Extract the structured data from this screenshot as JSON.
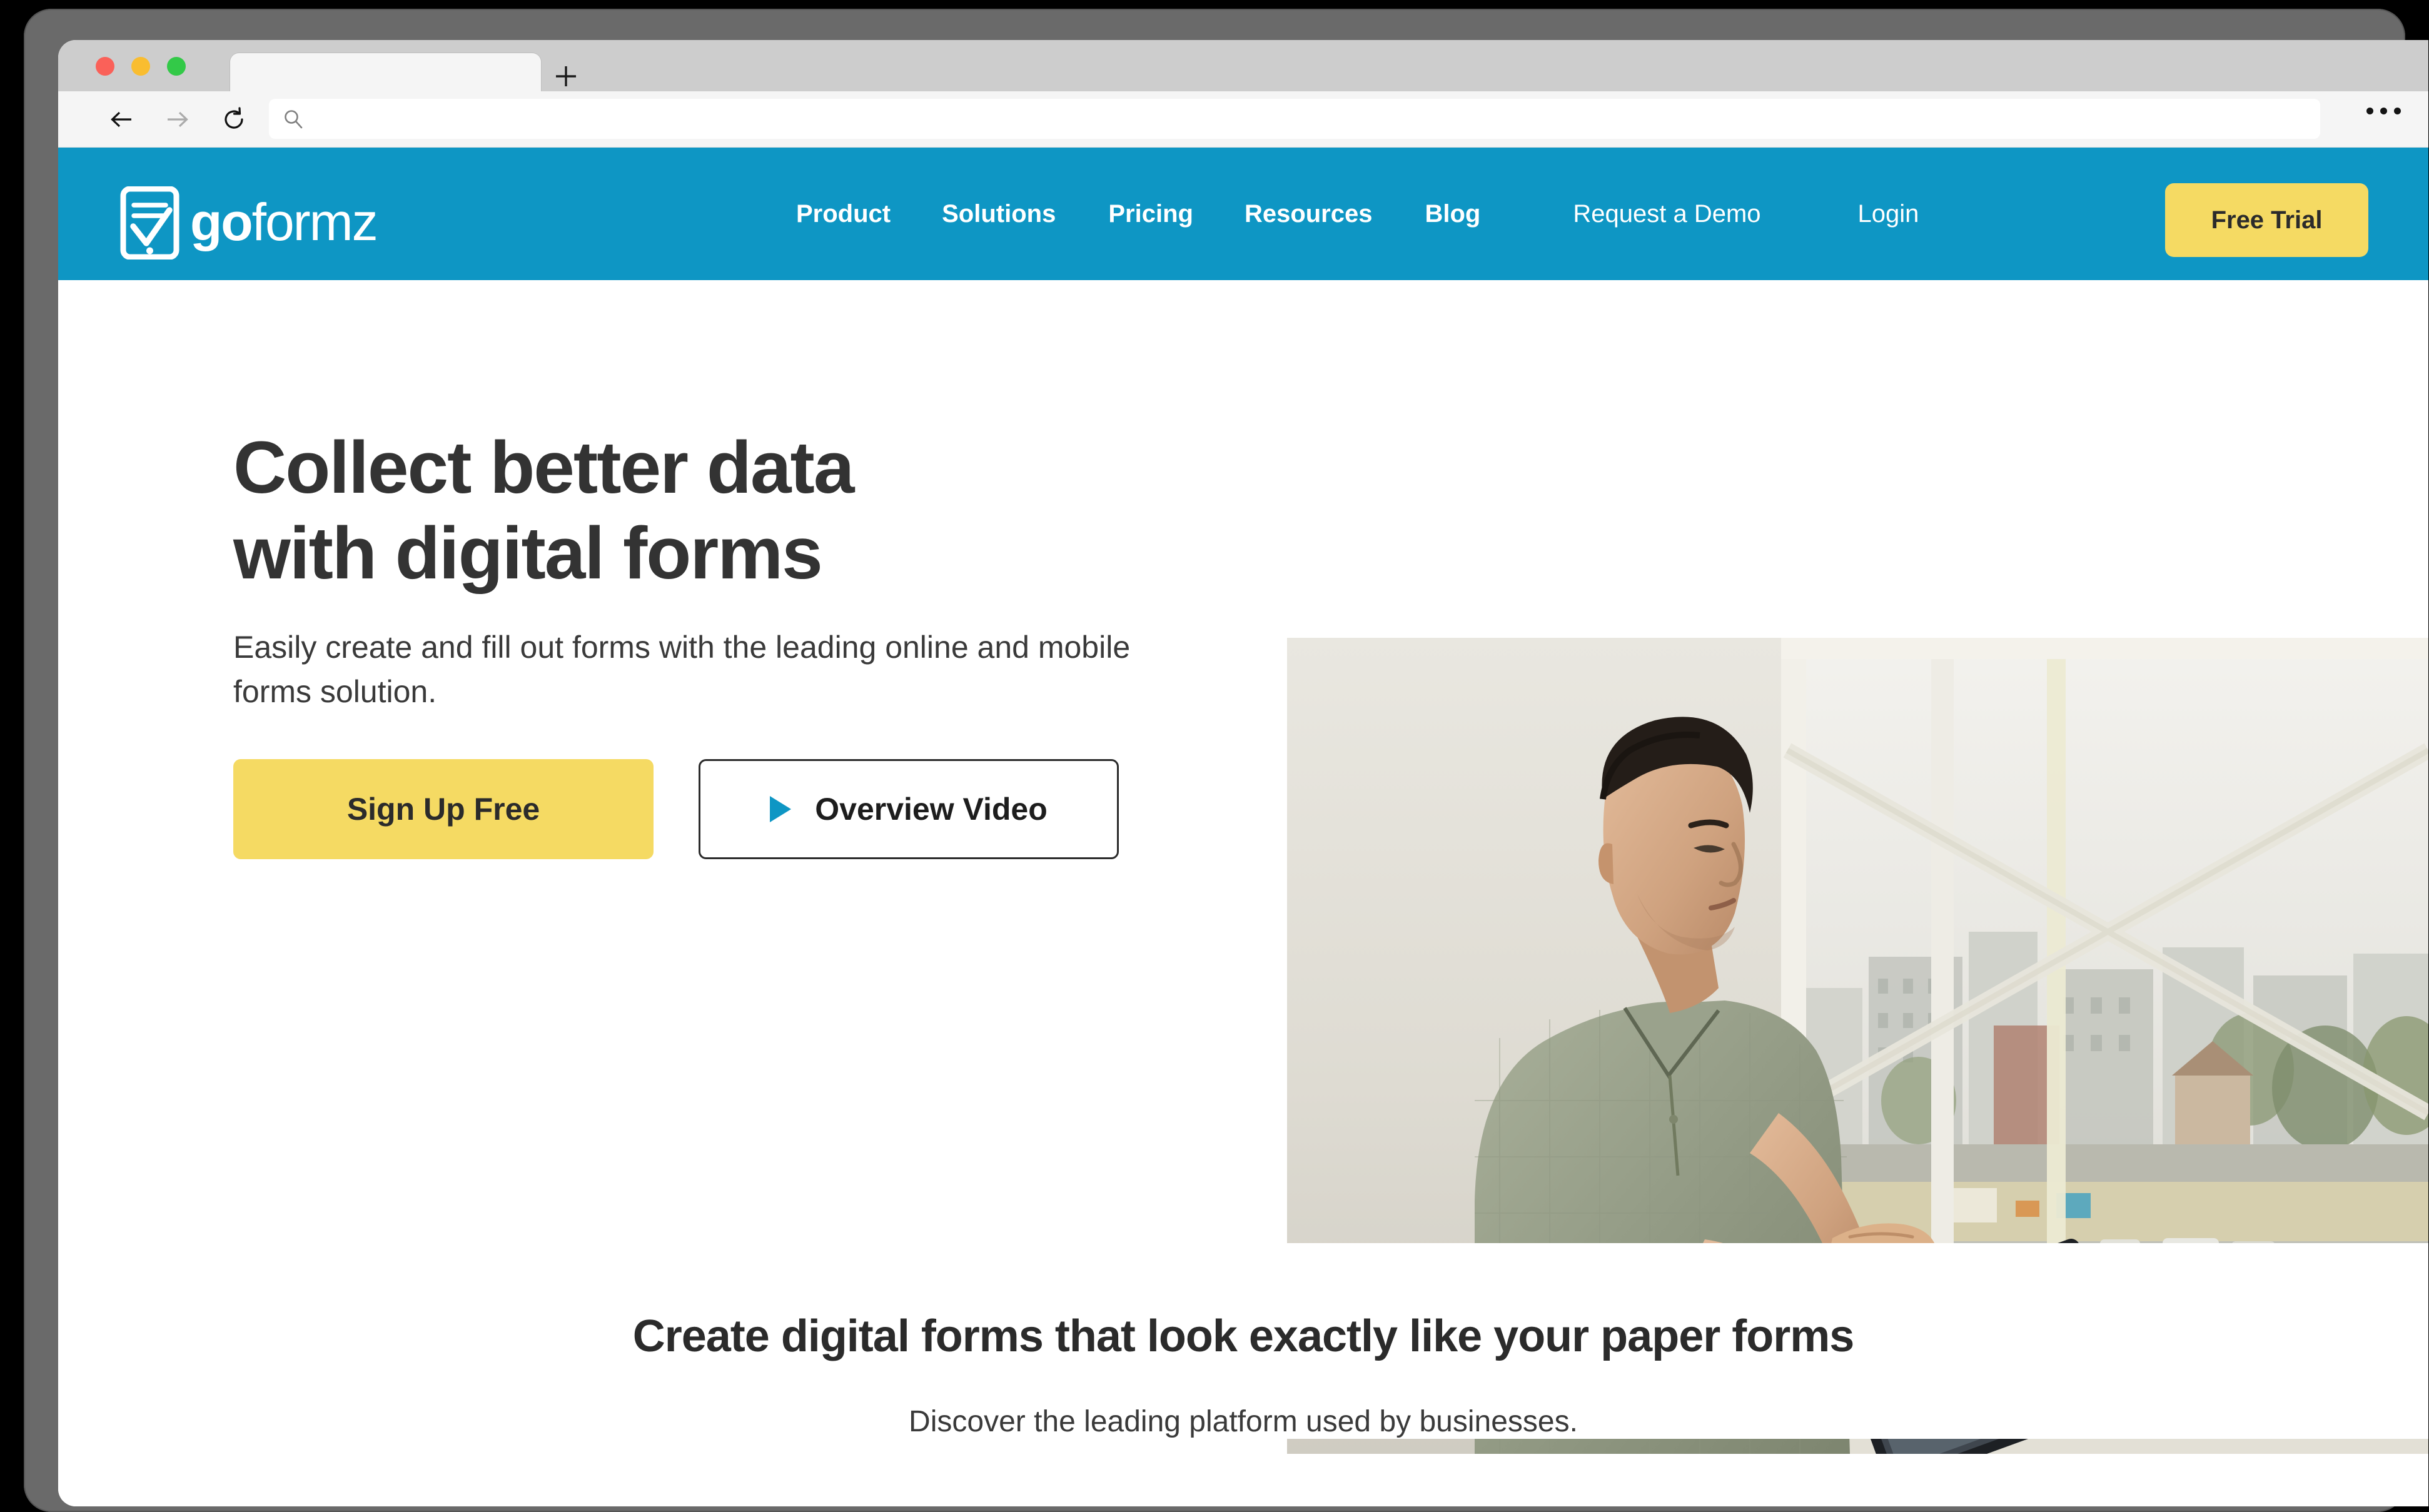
{
  "browser": {
    "tab_title": "",
    "address_value": "",
    "address_placeholder": "",
    "icons": {
      "back": "back-arrow-icon",
      "forward": "forward-arrow-icon",
      "reload": "reload-icon",
      "search": "search-icon",
      "new_tab": "plus-icon",
      "overflow": "overflow-menu-icon"
    },
    "traffic_lights": [
      "close",
      "minimize",
      "maximize"
    ]
  },
  "site": {
    "brand": {
      "wordmark_bold": "go",
      "wordmark_light": "formz",
      "logo_icon": "tablet-checkmark-icon"
    },
    "nav": [
      {
        "label": "Product",
        "weight": "bold"
      },
      {
        "label": "Solutions",
        "weight": "bold"
      },
      {
        "label": "Pricing",
        "weight": "bold"
      },
      {
        "label": "Resources",
        "weight": "bold"
      },
      {
        "label": "Blog",
        "weight": "bold"
      },
      {
        "label": "Request a Demo",
        "weight": "normal"
      },
      {
        "label": "Login",
        "weight": "normal"
      }
    ],
    "free_trial_label": "Free Trial"
  },
  "hero": {
    "heading_line1": "Collect better data",
    "heading_line2": "with digital forms",
    "subtext": "Easily create and fill out forms with the leading online and mobile forms solution.",
    "cta_primary": "Sign Up Free",
    "cta_secondary": "Overview Video",
    "play_icon": "play-triangle-icon",
    "image_alt": "man-with-tablet-by-window"
  },
  "section_forms": {
    "heading": "Create digital forms that look exactly like your paper forms",
    "subheading": "Discover the leading platform used by businesses."
  },
  "colors": {
    "brand_teal": "#0E96C4",
    "accent_yellow": "#F5DA63",
    "heading_dark": "#333333",
    "chrome_gray": "#CDCDCD",
    "toolbar_gray": "#F5F5F5"
  }
}
